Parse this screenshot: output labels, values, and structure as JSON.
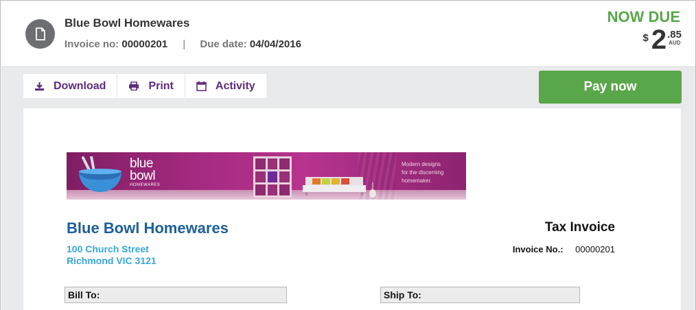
{
  "header": {
    "company_name": "Blue Bowl Homewares",
    "invoice_label": "Invoice no:",
    "invoice_number": "00000201",
    "separator": "|",
    "due_label": "Due date:",
    "due_date": "04/04/2016",
    "status": "NOW DUE",
    "amount": {
      "currency_symbol": "$",
      "whole": "2",
      "cents": ".85",
      "currency_code": "AUD"
    }
  },
  "toolbar": {
    "download_label": "Download",
    "print_label": "Print",
    "activity_label": "Activity",
    "pay_label": "Pay now"
  },
  "banner": {
    "brand_line1": "blue",
    "brand_line2": "bowl",
    "brand_sub": "HOMEWARES",
    "tagline_1": "Modern designs",
    "tagline_2": "for the discerning",
    "tagline_3": "homemaker."
  },
  "invoice": {
    "company_name": "Blue Bowl Homewares",
    "address_line1": "100 Church Street",
    "address_line2": "Richmond VIC 3121",
    "title": "Tax Invoice",
    "invoice_no_label": "Invoice No.:",
    "invoice_no": "00000201",
    "bill_to_label": "Bill To:",
    "ship_to_label": "Ship To:"
  },
  "colors": {
    "accent_green": "#5aa64a",
    "action_purple": "#5d2b7d",
    "company_blue": "#1d5f9a",
    "address_blue": "#35a6dc",
    "banner_magenta": "#a72b82"
  }
}
